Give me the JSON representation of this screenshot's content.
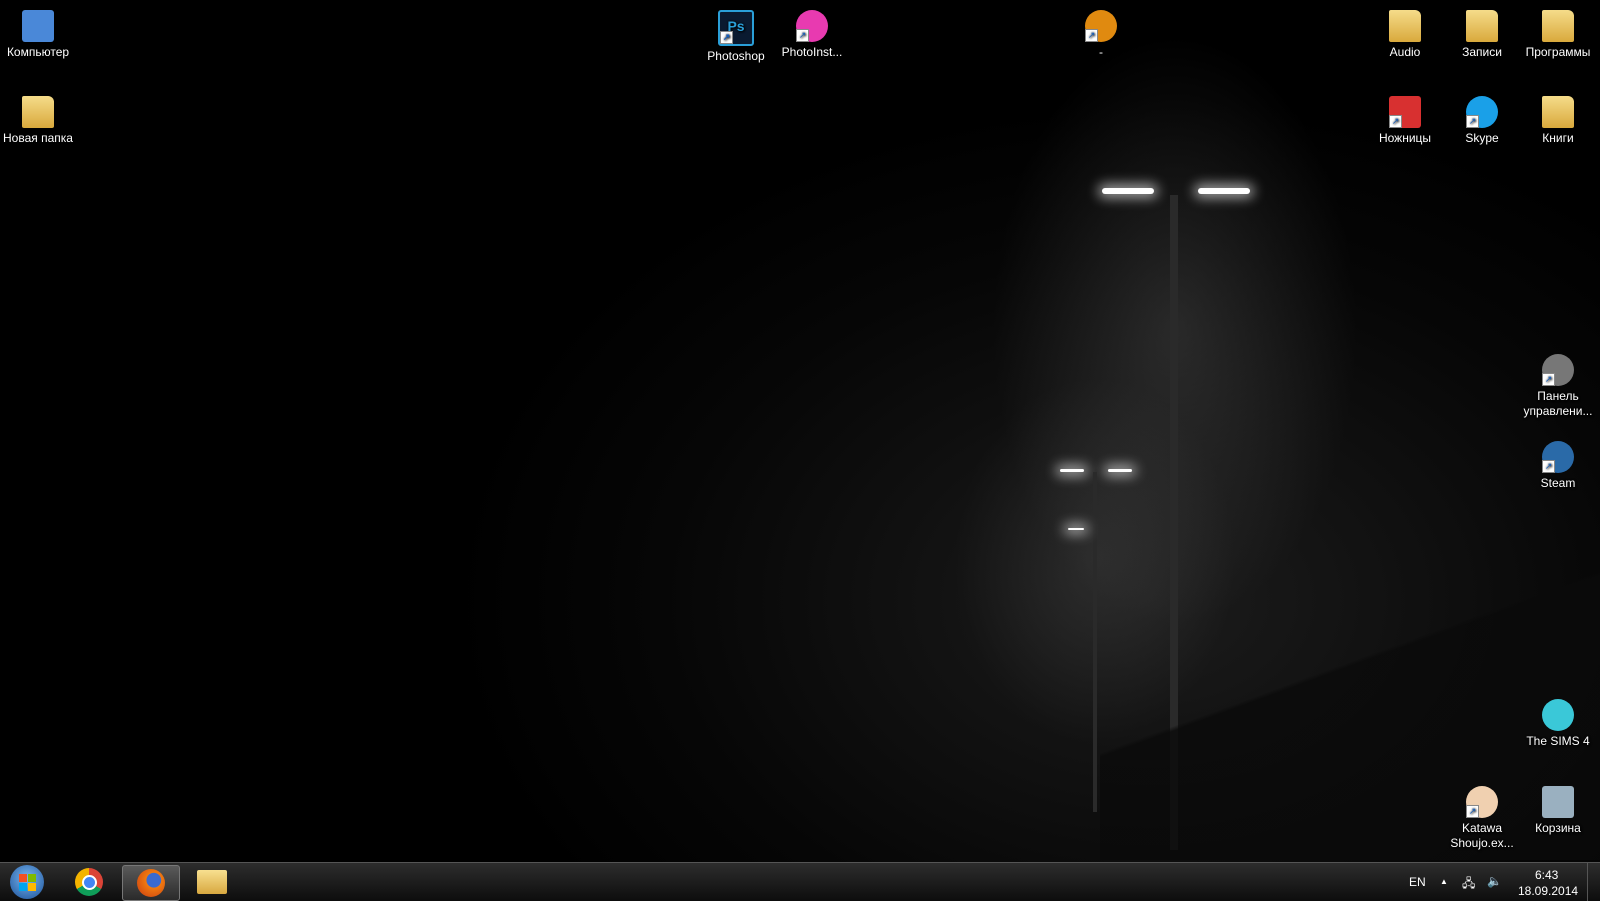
{
  "desktop": {
    "icons": [
      {
        "label": "Компьютер",
        "type": "computer",
        "color": "#4a88d8"
      },
      {
        "label": "Новая папка",
        "type": "folder",
        "color": "#e8c460"
      },
      {
        "label": "Photoshop",
        "type": "ps",
        "color": "#2a9fd8",
        "shortcut": true
      },
      {
        "label": "PhotoInst...",
        "type": "app",
        "color": "#e83ab0",
        "shortcut": true
      },
      {
        "label": "-",
        "type": "app",
        "color": "#e08a10",
        "shortcut": true
      },
      {
        "label": "Audio",
        "type": "folder",
        "color": "#e8c460"
      },
      {
        "label": "Записи",
        "type": "folder",
        "color": "#e8c460"
      },
      {
        "label": "Программы",
        "type": "folder",
        "color": "#e8c460"
      },
      {
        "label": "Ножницы",
        "type": "scissors",
        "color": "#d83030",
        "shortcut": true
      },
      {
        "label": "Skype",
        "type": "skype",
        "color": "#1aa0e8",
        "shortcut": true
      },
      {
        "label": "Книги",
        "type": "folder",
        "color": "#e8c460"
      },
      {
        "label": "Панель управлени...",
        "type": "app",
        "color": "#777777",
        "shortcut": true
      },
      {
        "label": "Steam",
        "type": "app",
        "color": "#2a6aa8",
        "shortcut": true
      },
      {
        "label": "The SIMS 4",
        "type": "app",
        "color": "#3ac8d8"
      },
      {
        "label": "Katawa Shoujo.ex...",
        "type": "app",
        "color": "#f0d0b0",
        "shortcut": true
      },
      {
        "label": "Корзина",
        "type": "bin",
        "color": "#9ab0c0"
      }
    ]
  },
  "taskbar": {
    "start": "start-button",
    "pinned": [
      {
        "name": "chrome"
      },
      {
        "name": "firefox",
        "active": true
      },
      {
        "name": "explorer"
      }
    ],
    "tray": {
      "language": "EN",
      "time": "6:43",
      "date": "18.09.2014"
    }
  }
}
